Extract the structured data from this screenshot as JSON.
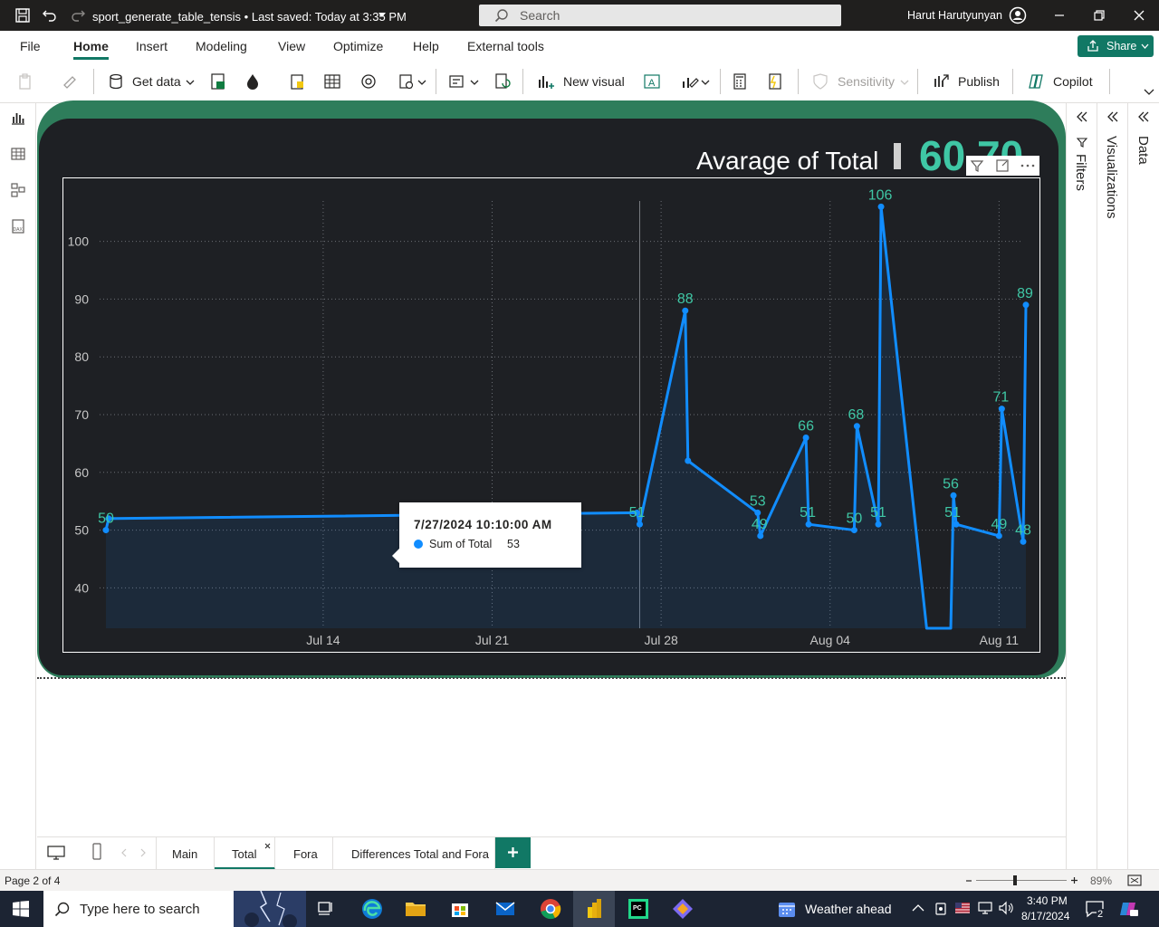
{
  "titlebar": {
    "doc_title": "sport_generate_table_tensis • Last saved: Today at 3:35 PM",
    "search_placeholder": "Search",
    "user_name": "Harut Harutyunyan"
  },
  "menu": {
    "items": [
      "File",
      "Home",
      "Insert",
      "Modeling",
      "View",
      "Optimize",
      "Help",
      "External tools"
    ],
    "share_label": "Share"
  },
  "ribbon": {
    "get_data": "Get data",
    "new_visual": "New visual",
    "sensitivity": "Sensitivity",
    "publish": "Publish",
    "copilot": "Copilot"
  },
  "panes": {
    "filters": "Filters",
    "visualizations": "Visualizations",
    "data": "Data"
  },
  "kpi": {
    "label": "Avarage of Total",
    "value": "60.70"
  },
  "chart_data": {
    "type": "line",
    "series": [
      {
        "name": "Sum of Total",
        "points": [
          {
            "x": "2024-07-05",
            "y": 50
          },
          {
            "x": "2024-07-05",
            "y": 52
          },
          {
            "x": "2024-07-27",
            "y": 53
          },
          {
            "x": "2024-07-27",
            "y": 51
          },
          {
            "x": "2024-07-29",
            "y": 88
          },
          {
            "x": "2024-07-29",
            "y": 62
          },
          {
            "x": "2024-08-01",
            "y": 53
          },
          {
            "x": "2024-08-01",
            "y": 49
          },
          {
            "x": "2024-08-03",
            "y": 66
          },
          {
            "x": "2024-08-03",
            "y": 51
          },
          {
            "x": "2024-08-05",
            "y": 50
          },
          {
            "x": "2024-08-05",
            "y": 68
          },
          {
            "x": "2024-08-06",
            "y": 51
          },
          {
            "x": "2024-08-06",
            "y": 106
          },
          {
            "x": "2024-08-08",
            "y": 33
          },
          {
            "x": "2024-08-09",
            "y": 33
          },
          {
            "x": "2024-08-09",
            "y": 56
          },
          {
            "x": "2024-08-09",
            "y": 51
          },
          {
            "x": "2024-08-11",
            "y": 49
          },
          {
            "x": "2024-08-11",
            "y": 71
          },
          {
            "x": "2024-08-12",
            "y": 48
          },
          {
            "x": "2024-08-12",
            "y": 89
          }
        ]
      }
    ],
    "data_labels": [
      {
        "x": "2024-07-05",
        "text": "50",
        "y": 50
      },
      {
        "x": "2024-07-27",
        "text": "51",
        "y": 51
      },
      {
        "x": "2024-07-29",
        "text": "88",
        "y": 88
      },
      {
        "x": "2024-08-01",
        "text": "53",
        "y": 53
      },
      {
        "x": "2024-08-01",
        "text": "49",
        "y": 49
      },
      {
        "x": "2024-08-03",
        "text": "66",
        "y": 66
      },
      {
        "x": "2024-08-03",
        "text": "51",
        "y": 51
      },
      {
        "x": "2024-08-05",
        "text": "50",
        "y": 50
      },
      {
        "x": "2024-08-05",
        "text": "68",
        "y": 68
      },
      {
        "x": "2024-08-06",
        "text": "51",
        "y": 51
      },
      {
        "x": "2024-08-06",
        "text": "106",
        "y": 106
      },
      {
        "x": "2024-08-09",
        "text": "56",
        "y": 56
      },
      {
        "x": "2024-08-09",
        "text": "51",
        "y": 51
      },
      {
        "x": "2024-08-11",
        "text": "49",
        "y": 49
      },
      {
        "x": "2024-08-11",
        "text": "71",
        "y": 71
      },
      {
        "x": "2024-08-12",
        "text": "48",
        "y": 48
      },
      {
        "x": "2024-08-12",
        "text": "89",
        "y": 89
      }
    ],
    "x_ticks": [
      "Jul 14",
      "Jul 21",
      "Jul 28",
      "Aug 04",
      "Aug 11"
    ],
    "y_ticks": [
      40,
      50,
      60,
      70,
      80,
      90,
      100
    ],
    "ylim": [
      33,
      107
    ],
    "grid": true,
    "line_color": "#118dff",
    "label_color": "#3fc7a5",
    "background": "#1e2024"
  },
  "tooltip": {
    "title": "7/27/2024 10:10:00 AM",
    "label": "Sum of Total",
    "value": "53"
  },
  "tabs": [
    "Main",
    "Total",
    "Fora",
    "Differences Total and Fora"
  ],
  "add_page_label": "+",
  "statusbar": {
    "page": "Page 2 of 4",
    "zoom": "89%"
  },
  "taskbar": {
    "search_placeholder": "Type here to search",
    "weather": "Weather ahead",
    "time": "3:40 PM",
    "date": "8/17/2024",
    "notifications": "2"
  },
  "colors": {
    "accent": "#117865",
    "frame": "#2e7d5b",
    "kpi_value": "#3fc7a5"
  }
}
